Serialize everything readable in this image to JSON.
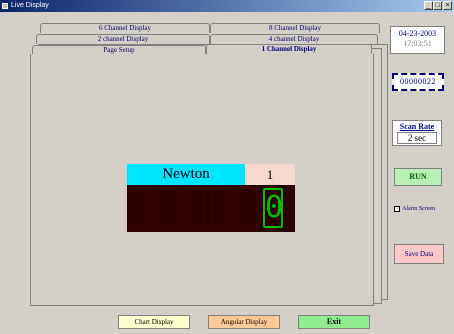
{
  "window": {
    "title": "Live Display",
    "controls": [
      "_",
      "□",
      "×"
    ]
  },
  "tabs": {
    "row1": [
      "6 Channel Display",
      "8 Channel Display"
    ],
    "row2": [
      "2 channel Display",
      "4 channel Display"
    ],
    "row3": [
      "Page Setup",
      "1 Channel Display"
    ]
  },
  "sidebar": {
    "date": "04-23-2003",
    "time": "17:03:51",
    "counter": "00000022",
    "scan_rate_label": "Scan Rate",
    "scan_rate_value": "2 sec",
    "run_label": "RUN",
    "alarm_label": "Alarm Screen",
    "save_label": "Save Data"
  },
  "display": {
    "unit": "Newton",
    "channel": "1",
    "reading_digits": [
      "",
      "",
      "",
      "",
      "",
      "0"
    ]
  },
  "bottom": {
    "chart_label": "Chart Display",
    "angular_label": "Angular Display",
    "exit_label": "Exit"
  },
  "colors": {
    "unit_bg": "#00e5ff",
    "channel_bg": "#f7d8cf",
    "display_bg": "#2a0000",
    "digit_active": "#00c000",
    "run_bg": "#b8f0b8",
    "exit_bg": "#90ee90",
    "chart_bg": "#ffffd0",
    "angular_bg": "#ffc896",
    "save_bg": "#ffc8c8"
  }
}
